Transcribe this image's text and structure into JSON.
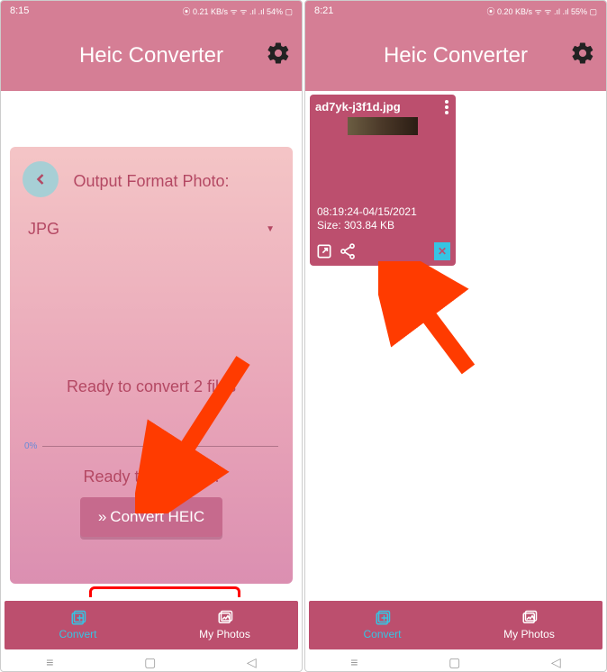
{
  "left": {
    "status": {
      "time": "8:15",
      "icons": "⦿ 0.21 KB/s ᯤ ᯤ .ıl .ıl 54% ▢"
    },
    "header": {
      "title": "Heic Converter"
    },
    "card": {
      "output_label": "Output Format Photo:",
      "dropdown_value": "JPG",
      "ready_files": "Ready to convert 2 files",
      "progress_pct": "0%",
      "ready_convert": "Ready to convert...",
      "button_label": "Convert HEIC"
    },
    "nav": {
      "convert": "Convert",
      "photos": "My Photos"
    }
  },
  "right": {
    "status": {
      "time": "8:21",
      "icons": "⦿ 0.20 KB/s ᯤ ᯤ .ıl .ıl 55% ▢"
    },
    "header": {
      "title": "Heic Converter"
    },
    "file": {
      "name": "ad7yk-j3f1d.jpg",
      "timestamp": "08:19:24-04/15/2021",
      "size": "Size: 303.84 KB"
    },
    "nav": {
      "convert": "Convert",
      "photos": "My Photos"
    }
  }
}
